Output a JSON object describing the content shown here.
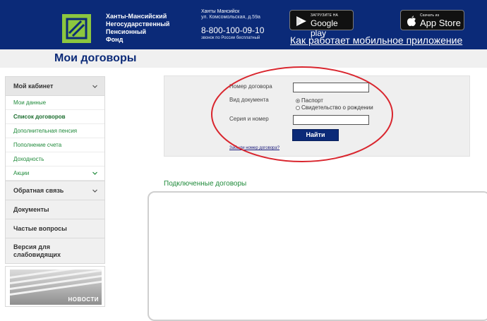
{
  "header": {
    "org_name": [
      "Ханты-Мансийский",
      "Негосударственный",
      "Пенсионный",
      "Фонд"
    ],
    "address_city": "Ханты Мансийск",
    "address_street": "ул. Комсомольская, д.59а",
    "phone": "8-800-100-09-10",
    "phone_note": "звонок по России бесплатный",
    "google_play": {
      "small": "ЗАГРУЗИТЕ НА",
      "big": "Google play"
    },
    "app_store": {
      "small": "Скачать из",
      "big": "App Store"
    },
    "mobile_link": "Как работает мобильное приложение"
  },
  "page_title": "Мои договоры",
  "sidebar": {
    "cabinet_label": "Мой кабинет",
    "sub_items": [
      {
        "label": "Мои данные",
        "active": false
      },
      {
        "label": "Список договоров",
        "active": true
      },
      {
        "label": "Дополнительная пенсия",
        "active": false
      },
      {
        "label": "Пополнение счета",
        "active": false
      },
      {
        "label": "Доходность",
        "active": false
      },
      {
        "label": "Акции",
        "active": false
      }
    ],
    "items": [
      "Обратная связь",
      "Документы",
      "Частые вопросы",
      "Версия для слабовидящих"
    ],
    "news_label": "НОВОСТИ"
  },
  "search_form": {
    "contract_number_label": "Номер договора",
    "contract_number_value": "",
    "doc_type_label": "Вид документа",
    "doc_options": [
      "Паспорт",
      "Свидетельство о рождении"
    ],
    "selected_option": "Паспорт",
    "series_label": "Серия и номер",
    "series_value": "",
    "find_button": "Найти",
    "forgot_link": "Забыли номер договора?"
  },
  "contracts_title": "Подключенные договоры",
  "colors": {
    "header_bg": "#0b2a78",
    "logo_green": "#8cc63f",
    "link_green": "#1f8a3a",
    "highlight_red": "#d9262e"
  }
}
